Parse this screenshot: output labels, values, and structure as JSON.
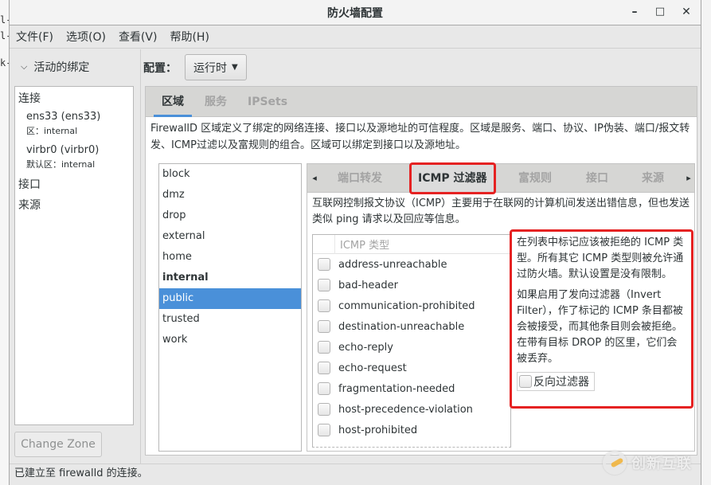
{
  "background": {
    "left_terminal_fragments": [
      "l-",
      "l-",
      "k-"
    ]
  },
  "window": {
    "title": "防火墙配置",
    "controls": {
      "minimize": "–",
      "maximize": "□",
      "close": "✕"
    }
  },
  "menubar": {
    "items": [
      "文件(F)",
      "选项(O)",
      "查看(V)",
      "帮助(H)"
    ]
  },
  "bindings": {
    "header": "活动的绑定",
    "categories": {
      "connections": "连接",
      "interfaces": "接口",
      "sources": "来源"
    },
    "connections": [
      {
        "name": "ens33 (ens33)",
        "zone": "区：internal"
      },
      {
        "name": "virbr0 (virbr0)",
        "zone": "默认区：internal"
      }
    ],
    "change_zone_label": "Change Zone"
  },
  "config": {
    "label": "配置：",
    "selected": "运行时"
  },
  "main_tabs": [
    {
      "label": "区域",
      "active": true
    },
    {
      "label": "服务",
      "active": false
    },
    {
      "label": "IPSets",
      "active": false
    }
  ],
  "zone_description": "FirewallD 区域定义了绑定的网络连接、接口以及源地址的可信程度。区域是服务、端口、协议、IP伪装、端口/报文转发、ICMP过滤以及富规则的组合。区域可以绑定到接口以及源地址。",
  "zones": [
    {
      "name": "block",
      "bold": false,
      "selected": false
    },
    {
      "name": "dmz",
      "bold": false,
      "selected": false
    },
    {
      "name": "drop",
      "bold": false,
      "selected": false
    },
    {
      "name": "external",
      "bold": false,
      "selected": false
    },
    {
      "name": "home",
      "bold": false,
      "selected": false
    },
    {
      "name": "internal",
      "bold": true,
      "selected": false
    },
    {
      "name": "public",
      "bold": false,
      "selected": true
    },
    {
      "name": "trusted",
      "bold": false,
      "selected": false
    },
    {
      "name": "work",
      "bold": false,
      "selected": false
    }
  ],
  "sub_tabs": [
    {
      "label": "端口转发",
      "active": false
    },
    {
      "label": "ICMP 过滤器",
      "active": true
    },
    {
      "label": "富规则",
      "active": false
    },
    {
      "label": "接口",
      "active": false
    },
    {
      "label": "来源",
      "active": false
    }
  ],
  "sub_nav": {
    "prev": "◂",
    "next": "▸"
  },
  "icmp": {
    "description": "互联网控制报文协议（ICMP）主要用于在联网的计算机间发送出错信息，但也发送类似 ping 请求以及回应等信息。",
    "column_header": "ICMP 类型",
    "types": [
      {
        "name": "address-unreachable",
        "checked": false
      },
      {
        "name": "bad-header",
        "checked": false
      },
      {
        "name": "communication-prohibited",
        "checked": false
      },
      {
        "name": "destination-unreachable",
        "checked": false
      },
      {
        "name": "echo-reply",
        "checked": false
      },
      {
        "name": "echo-request",
        "checked": false
      },
      {
        "name": "fragmentation-needed",
        "checked": false
      },
      {
        "name": "host-precedence-violation",
        "checked": false
      },
      {
        "name": "host-prohibited",
        "checked": false
      }
    ],
    "help_paragraph_1": "在列表中标记应该被拒绝的 ICMP 类型。所有其它 ICMP 类型则被允许通过防火墙。默认设置是没有限制。",
    "help_paragraph_2": "如果启用了发向过滤器（Invert Filter），作了标记的 ICMP 条目都被会被接受，而其他条目则会被拒绝。在带有目标 DROP 的区里，它们会被丢弃。",
    "invert_filter_label": "反向过滤器",
    "invert_filter_checked": false
  },
  "status": {
    "text": "已建立至  firewalld 的连接。"
  },
  "watermark": {
    "text": "创新互联"
  },
  "colors": {
    "selection": "#4a90d9",
    "highlight_outline": "#e52222"
  }
}
